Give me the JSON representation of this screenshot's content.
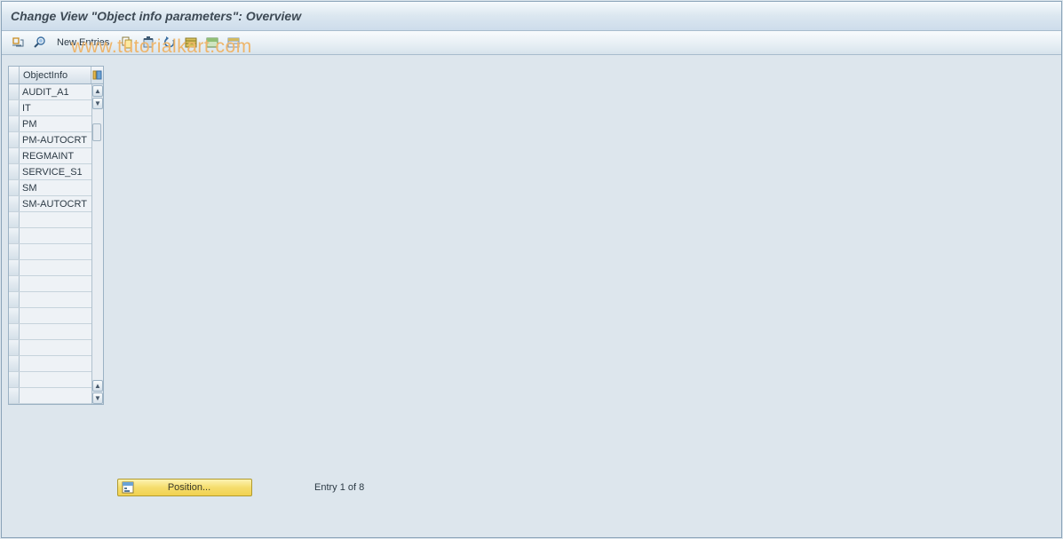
{
  "titlebar": {
    "title": "Change View \"Object info parameters\": Overview"
  },
  "toolbar": {
    "new_entries_label": "New Entries"
  },
  "watermark": "www.tutorialkart.com",
  "table": {
    "header_label": "ObjectInfo",
    "rows": [
      "AUDIT_A1",
      "IT",
      "PM",
      "PM-AUTOCRT",
      "REGMAINT",
      "SERVICE_S1",
      "SM",
      "SM-AUTOCRT",
      "",
      "",
      "",
      "",
      "",
      "",
      "",
      "",
      "",
      "",
      "",
      ""
    ]
  },
  "footer": {
    "position_label": "Position...",
    "entry_text": "Entry 1 of 8"
  }
}
